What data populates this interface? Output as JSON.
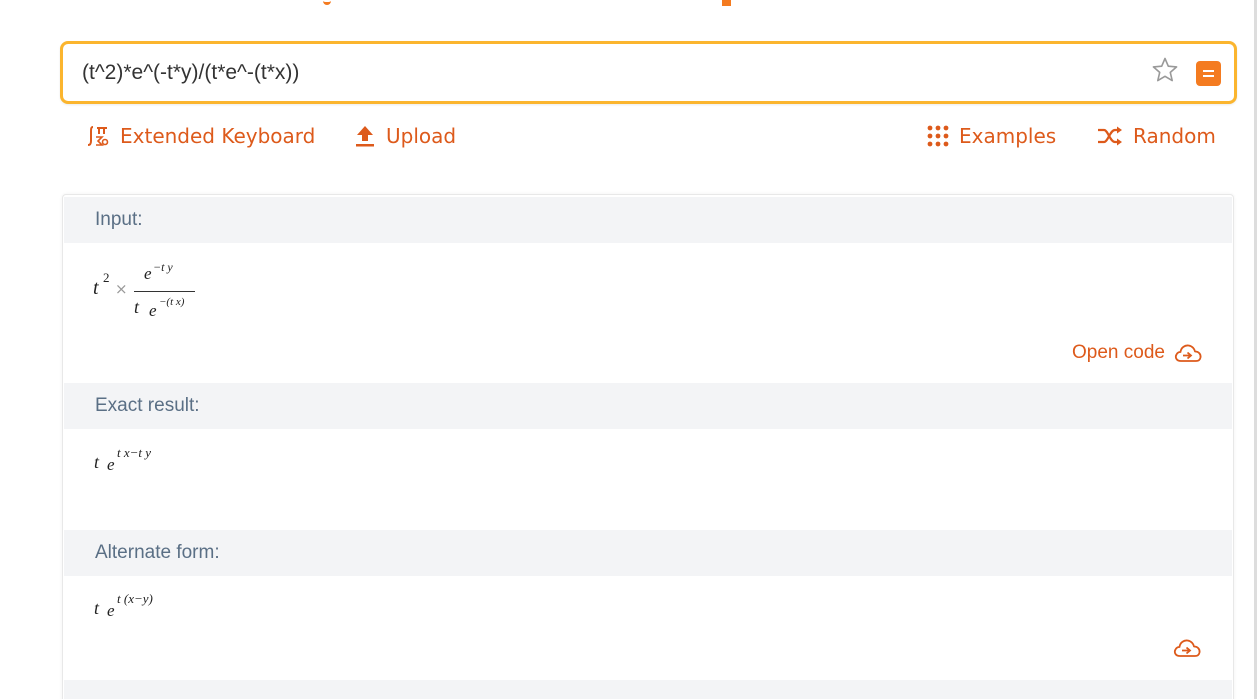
{
  "search": {
    "value": "(t^2)*e^(-t*y)/(t*e^-(t*x))"
  },
  "toolbar": {
    "extended_keyboard": "Extended Keyboard",
    "upload": "Upload",
    "examples": "Examples",
    "random": "Random"
  },
  "pods": [
    {
      "title": "Input:",
      "math": {
        "factor_base": "t",
        "factor_exp": "2",
        "times": "×",
        "num_base": "e",
        "num_exp": "−t y",
        "den_lead": "t",
        "den_base": "e",
        "den_exp": "−(t x)"
      },
      "action": "Open code"
    },
    {
      "title": "Exact result:",
      "math": {
        "lead": "t",
        "base": "e",
        "exp": "t x−t y"
      }
    },
    {
      "title": "Alternate form:",
      "math": {
        "lead": "t",
        "base": "e",
        "exp": "t (x−y)"
      }
    }
  ],
  "colors": {
    "accent": "#dd5a1b",
    "search_border": "#fbb52e",
    "brand": "#f47b20",
    "pod_header_bg": "#f3f4f6",
    "pod_title": "#5a6f85"
  },
  "icons": {
    "extended_keyboard": "integral-pi-icon",
    "upload": "upload-arrow-icon",
    "examples": "grid-dots-icon",
    "random": "shuffle-icon",
    "favorite": "star-icon",
    "menu": "menu-icon",
    "open_code": "cloud-upload-icon"
  }
}
